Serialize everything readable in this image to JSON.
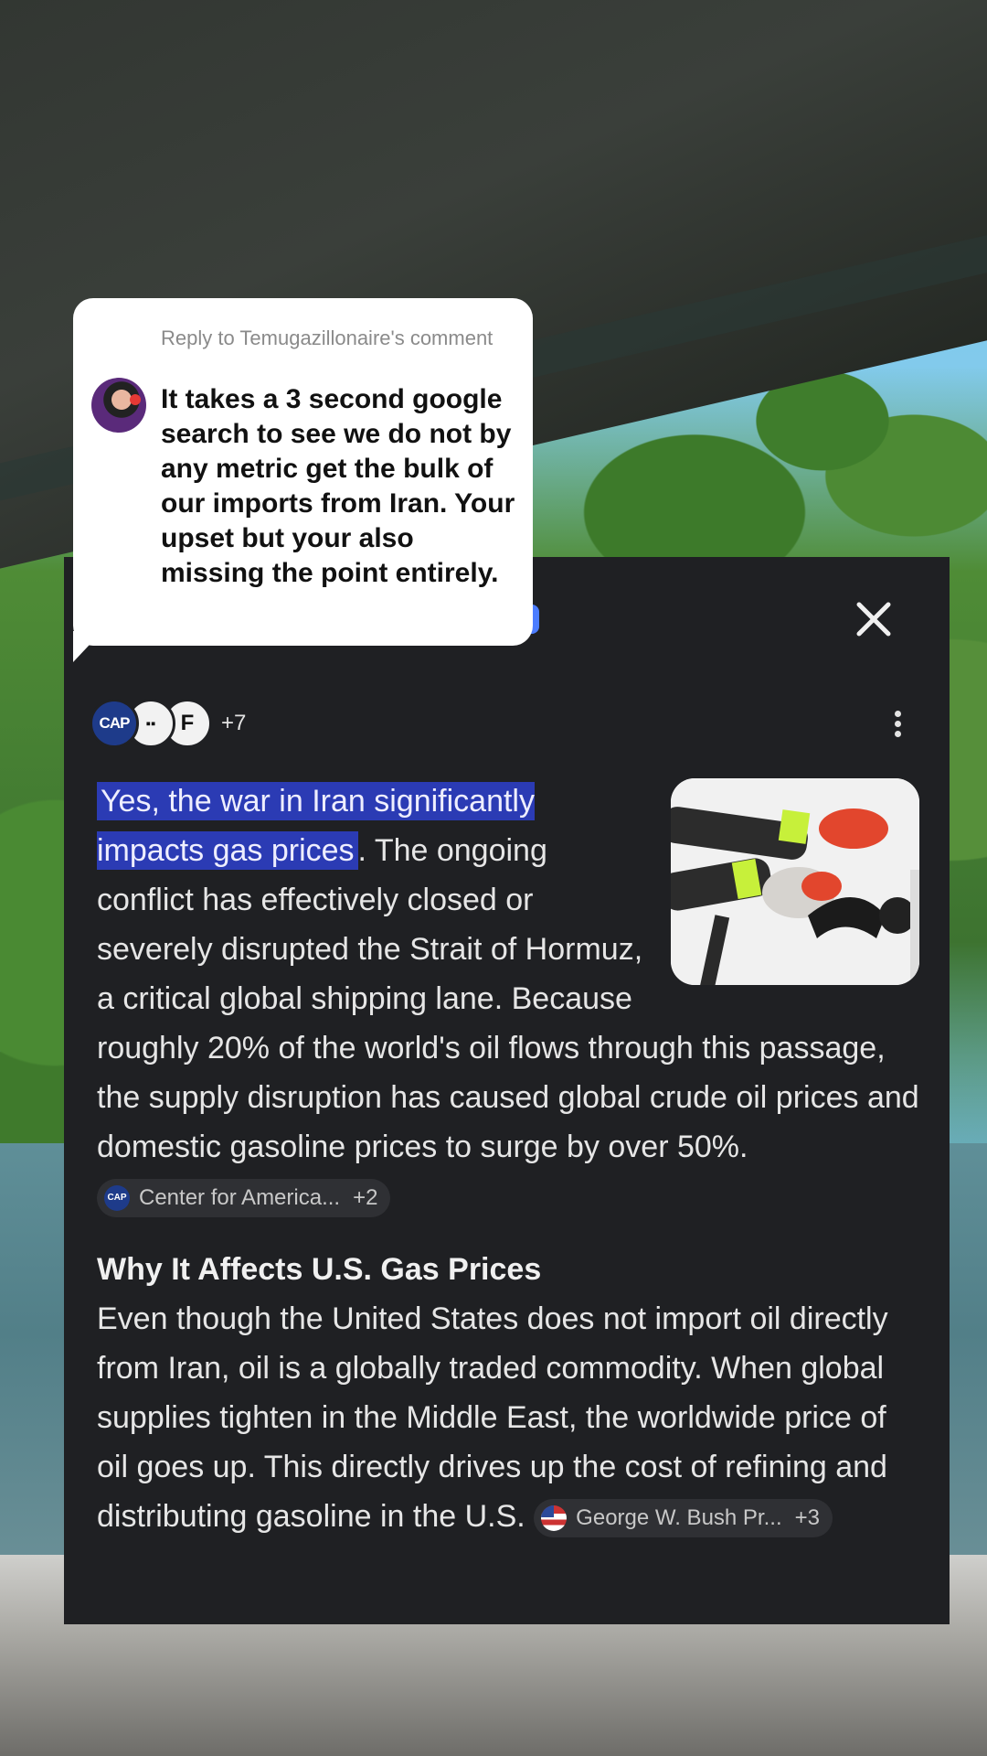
{
  "bubble": {
    "reply_to": "Reply to Temugazillonaire's comment",
    "text": "It takes a 3 second google search to see we do not by any metric get the bulk of our imports from Iran. Your upset but your also missing the point entirely."
  },
  "panel": {
    "close_icon": "✕",
    "sources": {
      "avatar_1": "CAP",
      "avatar_2": "▪▪",
      "avatar_3": "F",
      "more": "+7"
    },
    "answer": {
      "highlight": "Yes, the war in Iran significantly impacts gas prices",
      "body": ". The ongoing conflict has effectively closed or severely disrupted the Strait of Hormuz, a critical global shipping lane. Because roughly 20% of the world's oil flows through this passage, the supply disruption has caused global crude oil prices and domestic gasoline prices to surge by over 50%. ",
      "chip_1": {
        "icon_text": "CAP",
        "label": "Center for America...",
        "more": "+2"
      }
    },
    "section": {
      "heading": "Why It Affects U.S. Gas Prices",
      "body": "Even though the United States does not import oil directly from Iran, oil is a globally traded commodity. When global supplies tighten in the Middle East, the worldwide price of oil goes up. This directly drives up the cost of refining and distributing gasoline in the U.S. ",
      "chip_2": {
        "label": "George W. Bush Pr...",
        "more": "+3"
      }
    }
  },
  "colors": {
    "panel_bg": "#1f2023",
    "highlight": "#2b3bb4",
    "chip_bg": "#2f3034"
  }
}
